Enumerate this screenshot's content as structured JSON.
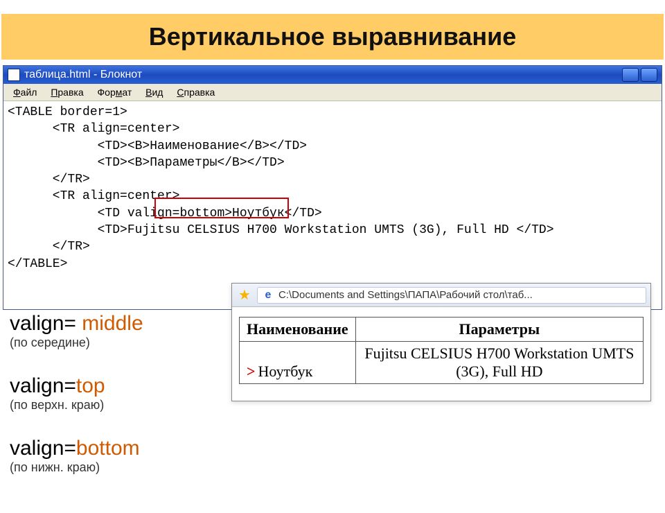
{
  "slide": {
    "title": "Вертикальное выравнивание"
  },
  "notepad": {
    "title": "таблица.html - Блокнот",
    "menu": {
      "file": "Файл",
      "edit": "Правка",
      "format": "Формат",
      "view": "Вид",
      "help": "Справка"
    },
    "code": {
      "l1": "<TABLE border=1>",
      "l2": "      <TR align=center>",
      "l3": "            <TD><B>Наименование</B></TD>",
      "l4": "            <TD><B>Параметры</B></TD>",
      "l5": "      </TR>",
      "l6": "      <TR align=center>",
      "l7": "            <TD valign=bottom>Ноутбук</TD>",
      "l8": "            <TD>Fujitsu CELSIUS H700 Workstation UMTS (3G), Full HD </TD>",
      "l9": "      </TR>",
      "l10": "</TABLE>"
    }
  },
  "valign": {
    "middle": {
      "attr": "valign= ",
      "val": "middle",
      "desc": "(по середине)"
    },
    "top": {
      "attr": "valign=",
      "val": "top",
      "desc": "(по верхн. краю)"
    },
    "bottom": {
      "attr": "valign=",
      "val": "bottom",
      "desc": "(по нижн. краю)"
    }
  },
  "ie": {
    "path": "C:\\Documents and Settings\\ПАПА\\Рабочий стол\\таб...",
    "table": {
      "h1": "Наименование",
      "h2": "Параметры",
      "c1": "Ноутбук",
      "c2": "Fujitsu CELSIUS H700 Workstation UMTS (3G), Full HD"
    }
  }
}
